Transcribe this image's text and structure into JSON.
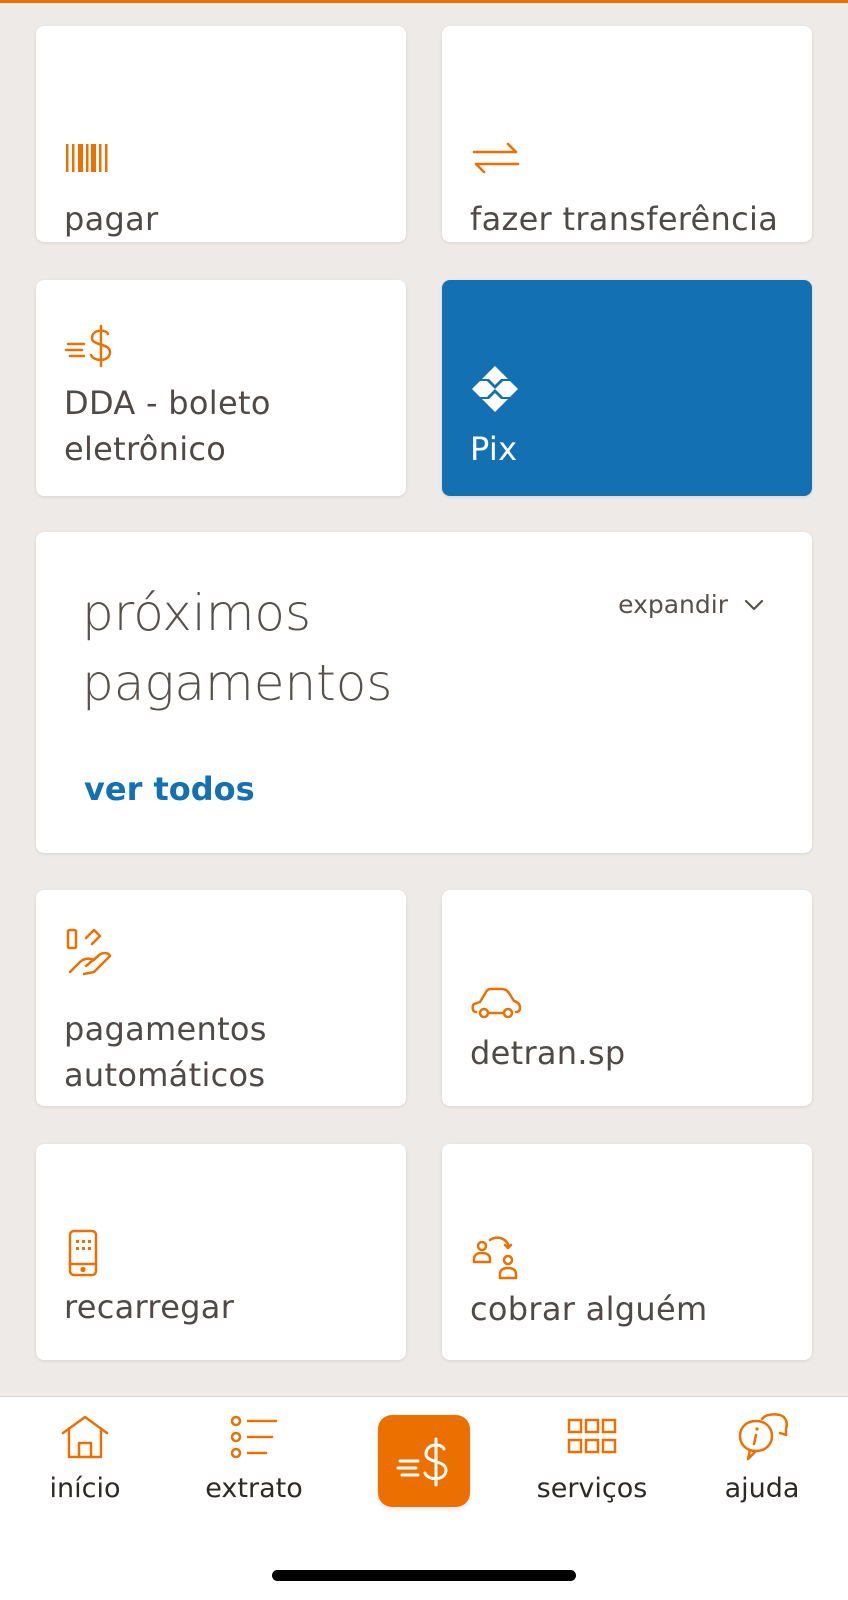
{
  "colors": {
    "accent": "#ec7000",
    "pix_blue": "#1270b3",
    "background": "#eeeae7"
  },
  "tiles": {
    "pay": {
      "label": "pagar",
      "icon": "barcode-icon"
    },
    "transfer": {
      "label": "fazer transferência",
      "icon": "transfer-arrows-icon"
    },
    "dda": {
      "label": "DDA - boleto eletrônico",
      "icon": "fast-money-icon"
    },
    "pix": {
      "label": "Pix",
      "icon": "pix-icon"
    },
    "auto_payments": {
      "label": "pagamentos automáticos",
      "icon": "hand-payment-icon"
    },
    "detran": {
      "label": "detran.sp",
      "icon": "car-icon"
    },
    "recharge": {
      "label": "recarregar",
      "icon": "phone-icon"
    },
    "charge": {
      "label": "cobrar alguém",
      "icon": "request-money-people-icon"
    }
  },
  "upcoming": {
    "title": "próximos pagamentos",
    "expand_label": "expandir",
    "see_all_label": "ver todos"
  },
  "bottom_nav": {
    "home": "início",
    "statement": "extrato",
    "services": "serviços",
    "help": "ajuda",
    "center_icon": "fast-money-icon"
  }
}
